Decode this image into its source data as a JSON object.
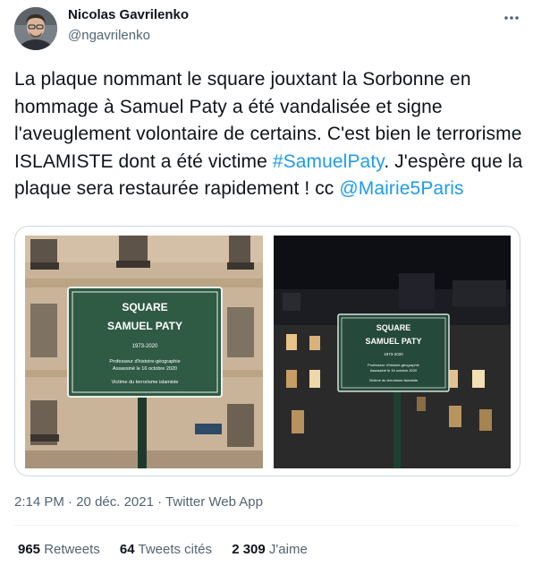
{
  "author": {
    "name": "Nicolas Gavrilenko",
    "handle": "@ngavrilenko"
  },
  "tweet": {
    "text_before_hashtag": "La plaque nommant le square jouxtant la Sorbonne en hommage à Samuel Paty a été vandalisée et signe l'aveuglement volontaire de certains. C'est bien le terrorisme ISLAMISTE dont a été victime ",
    "hashtag": "#SamuelPaty",
    "text_after_hashtag": ". J'espère que la plaque sera restaurée rapidement ! cc ",
    "mention": "@Mairie5Paris"
  },
  "media": {
    "sign": {
      "line1": "SQUARE",
      "line2": "SAMUEL PATY",
      "line3": "1973-2020",
      "line4": "Professeur d'histoire-géographie",
      "line5": "Assassiné le 16 octobre 2020",
      "line6": "Victime du terrorisme islamiste"
    },
    "colors": {
      "sign_green": "#2f5a44",
      "facade": "#c9b49a",
      "night_sky": "#0d0f14"
    }
  },
  "meta": {
    "time": "2:14 PM",
    "separator1": " · ",
    "date": "20 déc. 2021",
    "separator2": " · ",
    "source": "Twitter Web App"
  },
  "stats": {
    "retweets_count": "965",
    "retweets_label": "Retweets",
    "quotes_count": "64",
    "quotes_label": "Tweets cités",
    "likes_count": "2 309",
    "likes_label": "J'aime"
  },
  "icons": {
    "more": "more-horizontal-icon"
  }
}
